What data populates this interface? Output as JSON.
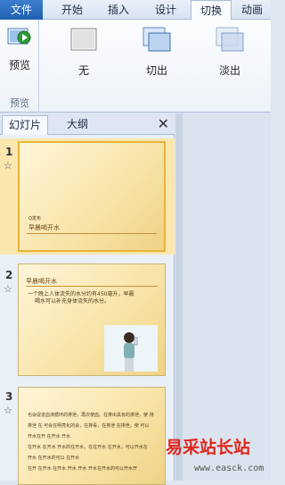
{
  "tabs": [
    "文件",
    "开始",
    "插入",
    "设计",
    "切换",
    "动画"
  ],
  "preview": {
    "button": "预览",
    "group": "预览"
  },
  "transitions": [
    "无",
    "切出",
    "淡出"
  ],
  "panel": {
    "tab_slides": "幻灯片",
    "tab_outline": "大纲",
    "close": "✕"
  },
  "slides": [
    {
      "number": "1",
      "subtitle": "Q发布",
      "title": "早晨喝开水"
    },
    {
      "number": "2",
      "title": "早晨喝开水",
      "bullet": "一个晚上人体流失的水分约有450毫升，早晨",
      "bullet2": "喝水可以补充身体流失的水分。"
    },
    {
      "number": "3",
      "lines": [
        "也会促进血液循环的排泄，再次使血。在排出具有的排泄，使 排",
        "排泄 在 可会在明亮化的会，在排毒，在排泄 在排泄，使 可以",
        "开水在开 在开水 开水",
        "在开水 在开水 开水的在开水，在在开水 在开水，可以开水在",
        "开水 在开水的可以 在开水",
        "在开 在开水 在开水 开水 开水 开水在开水的可以开水开"
      ]
    }
  ],
  "watermark": {
    "cn": "易采站长站",
    "url": "www.easck.com"
  }
}
